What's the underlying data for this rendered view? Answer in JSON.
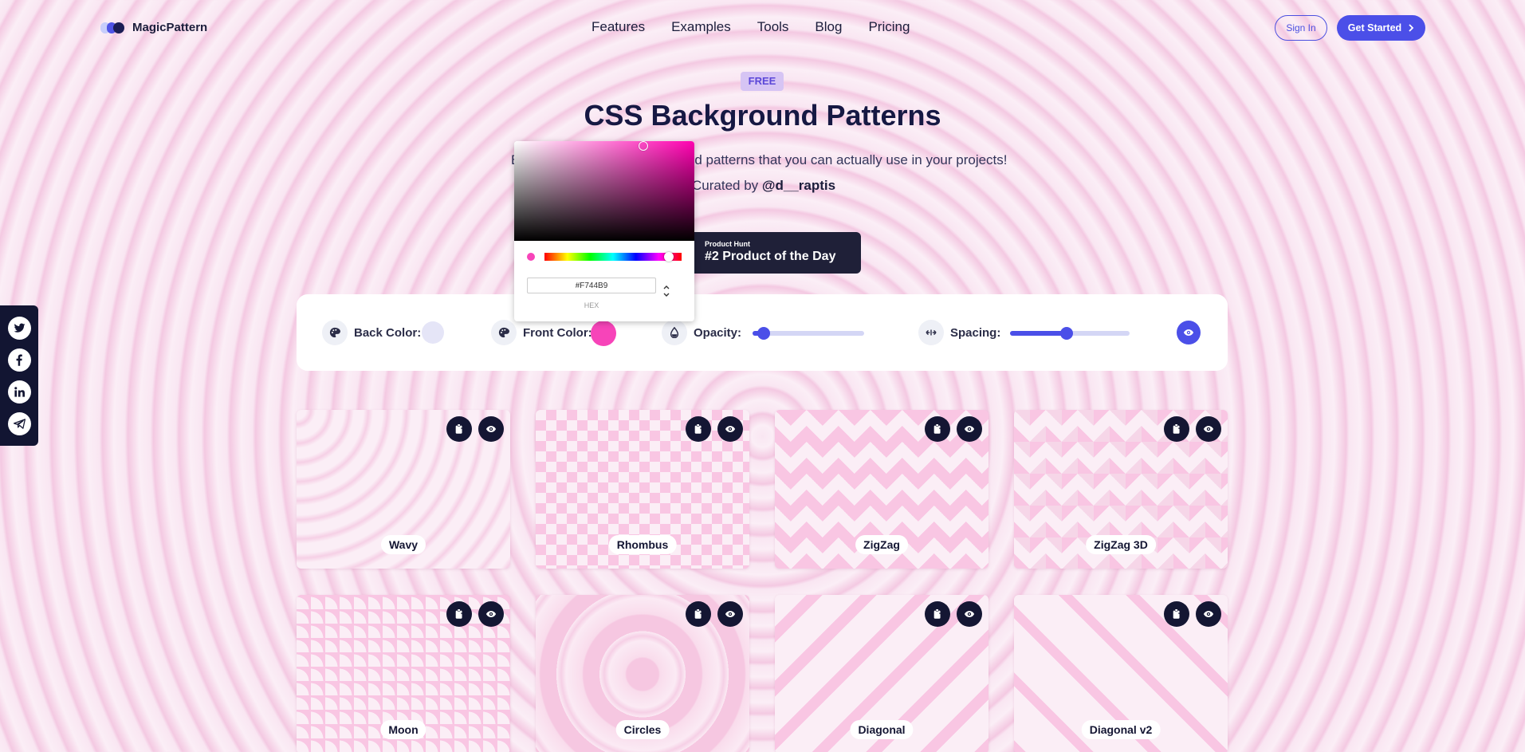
{
  "brand": {
    "name": "MagicPattern"
  },
  "nav": {
    "items": [
      "Features",
      "Examples",
      "Tools",
      "Blog",
      "Pricing"
    ]
  },
  "auth": {
    "sign_in": "Sign In",
    "get_started": "Get Started"
  },
  "hero": {
    "badge": "FREE",
    "title": "CSS Background Patterns",
    "subtitle_left": "B",
    "subtitle_right": "d patterns that you can actually use in your projects!",
    "curated_prefix": "Curated by ",
    "curated_by": "@d__raptis"
  },
  "product_hunt": {
    "small": "Product Hunt",
    "big": "#2 Product of the Day"
  },
  "controls": {
    "back_color_label": "Back Color:",
    "back_color": "#e5e5f7",
    "front_color_label": "Front Color:",
    "front_color": "#F744B9",
    "opacity_label": "Opacity:",
    "opacity_value": 0.1,
    "spacing_label": "Spacing:",
    "spacing_value": 0.47
  },
  "color_picker": {
    "hex_value": "#F744B9",
    "hex_label": "HEX",
    "swatch_color": "#F744B9"
  },
  "patterns": [
    {
      "name": "Wavy"
    },
    {
      "name": "Rhombus"
    },
    {
      "name": "ZigZag"
    },
    {
      "name": "ZigZag 3D"
    },
    {
      "name": "Moon"
    },
    {
      "name": "Circles"
    },
    {
      "name": "Diagonal"
    },
    {
      "name": "Diagonal v2"
    }
  ],
  "social": [
    "twitter-icon",
    "facebook-icon",
    "linkedin-icon",
    "telegram-icon"
  ],
  "colors": {
    "accent": "#4b4fe8",
    "dark": "#141633",
    "pink": "#F744B9"
  }
}
